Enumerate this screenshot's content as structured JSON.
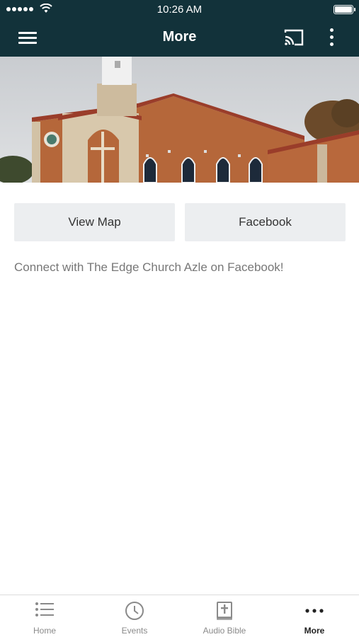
{
  "status_bar": {
    "time": "10:26 AM"
  },
  "header": {
    "title": "More"
  },
  "actions": {
    "view_map": "View Map",
    "facebook": "Facebook"
  },
  "description": "Connect with The Edge Church Azle on Facebook!",
  "tabbar": {
    "items": [
      {
        "label": "Home",
        "icon": "list-icon"
      },
      {
        "label": "Events",
        "icon": "clock-icon"
      },
      {
        "label": "Audio Bible",
        "icon": "bible-icon"
      },
      {
        "label": "More",
        "icon": "more-dots-icon",
        "active": true
      }
    ]
  },
  "colors": {
    "header_bg": "#12323a",
    "button_bg": "#eceef0",
    "active_tab": "#222222"
  }
}
